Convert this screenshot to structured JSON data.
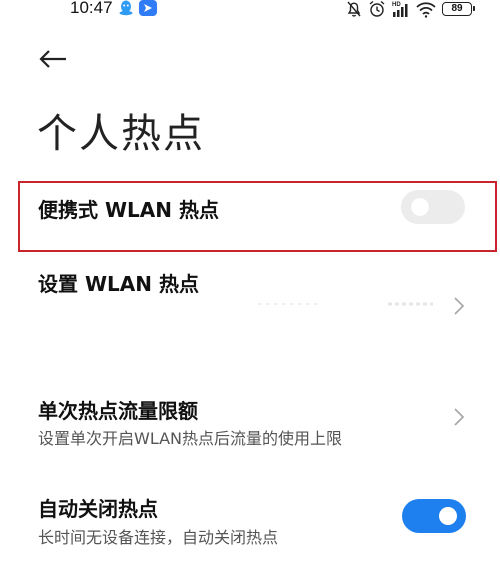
{
  "status_bar": {
    "time": "10:47",
    "battery": "89",
    "network_label": "HD"
  },
  "header": {
    "back_icon": "arrow-left-icon",
    "title": "个人热点"
  },
  "settings": {
    "portable_hotspot": {
      "label": "便携式 WLAN 热点",
      "enabled": false
    },
    "setup_hotspot": {
      "label": "设置 WLAN 热点"
    },
    "data_limit": {
      "label": "单次热点流量限额",
      "description": "设置单次开启WLAN热点后流量的使用上限"
    },
    "auto_off": {
      "label": "自动关闭热点",
      "description": "长时间无设备连接，自动关闭热点",
      "enabled": true
    }
  },
  "colors": {
    "accent": "#1e80ee",
    "highlight": "#c8242b",
    "toggle_off": "#ececec"
  }
}
